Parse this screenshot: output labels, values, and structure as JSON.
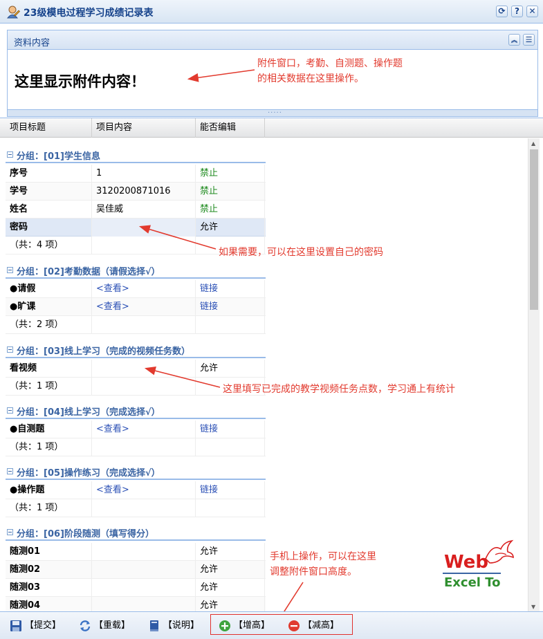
{
  "window": {
    "title": "23级模电过程学习成绩记录表"
  },
  "attachment": {
    "header": "资料内容",
    "content": "这里显示附件内容！",
    "grip": "....."
  },
  "columns": [
    "项目标题",
    "项目内容",
    "能否编辑"
  ],
  "groups": {
    "g1": {
      "label": "分组：[01]学生信息",
      "rows": [
        {
          "title": "序号",
          "content": "1",
          "edit": "禁止"
        },
        {
          "title": "学号",
          "content": "3120200871016",
          "edit": "禁止"
        },
        {
          "title": "姓名",
          "content": "吴佳威",
          "edit": "禁止"
        },
        {
          "title": "密码",
          "content": "",
          "edit": "允许"
        }
      ],
      "count": "（共：4 项）"
    },
    "g2": {
      "label": "分组：[02]考勤数据（请假选择√）",
      "rows": [
        {
          "title": "●请假",
          "content": "<查看>",
          "edit": "链接"
        },
        {
          "title": "●旷课",
          "content": "<查看>",
          "edit": "链接"
        }
      ],
      "count": "（共：2 项）"
    },
    "g3": {
      "label": "分组：[03]线上学习（完成的视频任务数）",
      "rows": [
        {
          "title": "看视频",
          "content": "",
          "edit": "允许"
        }
      ],
      "count": "（共：1 项）"
    },
    "g4": {
      "label": "分组：[04]线上学习（完成选择√）",
      "rows": [
        {
          "title": "●自测题",
          "content": "<查看>",
          "edit": "链接"
        }
      ],
      "count": "（共：1 项）"
    },
    "g5": {
      "label": "分组：[05]操作练习（完成选择√）",
      "rows": [
        {
          "title": "●操作题",
          "content": "<查看>",
          "edit": "链接"
        }
      ],
      "count": "（共：1 项）"
    },
    "g6": {
      "label": "分组：[06]阶段随测（填写得分）",
      "rows": [
        {
          "title": "随测01",
          "content": "",
          "edit": "允许"
        },
        {
          "title": "随测02",
          "content": "",
          "edit": "允许"
        },
        {
          "title": "随测03",
          "content": "",
          "edit": "允许"
        },
        {
          "title": "随测04",
          "content": "",
          "edit": "允许"
        }
      ]
    }
  },
  "toolbar": {
    "submit": "【提交】",
    "reload": "【重载】",
    "help": "【说明】",
    "increase": "【增高】",
    "decrease": "【减高】"
  },
  "notes": {
    "n1a": "附件窗口，考勤、自测题、操作题",
    "n1b": "的相关数据在这里操作。",
    "n2": "如果需要，可以在这里设置自己的密码",
    "n3": "这里填写已完成的教学视频任务点数，学习通上有统计",
    "n4a": "手机上操作，可以在这里",
    "n4b": "调整附件窗口高度。"
  },
  "logo": {
    "web": "Web",
    "sub": "Excel To"
  },
  "colors": {
    "accent": "#15428b",
    "border": "#99bbe8",
    "note": "#e23a2e",
    "allowed": "#1d8a1d",
    "link": "#2a4fb5"
  }
}
